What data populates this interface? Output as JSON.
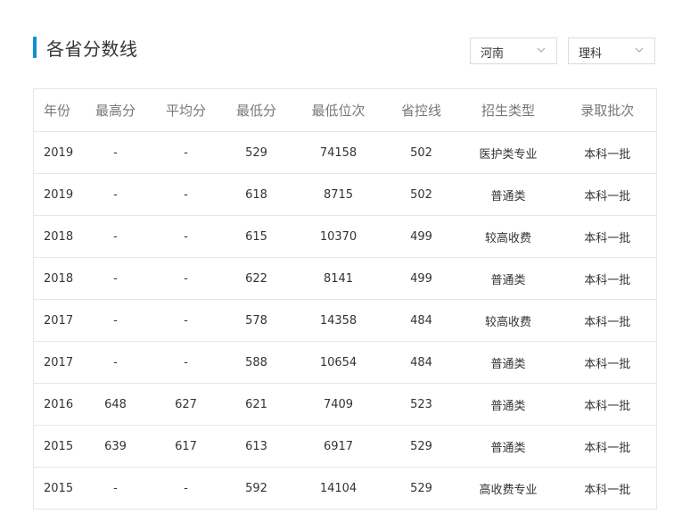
{
  "section": {
    "title": "各省分数线",
    "accent_color": "#0f8fd6"
  },
  "filters": {
    "province": "河南",
    "subject": "理科"
  },
  "table": {
    "columns": [
      "年份",
      "最高分",
      "平均分",
      "最低分",
      "最低位次",
      "省控线",
      "招生类型",
      "录取批次"
    ],
    "rows": [
      [
        "2019",
        "-",
        "-",
        "529",
        "74158",
        "502",
        "医护类专业",
        "本科一批"
      ],
      [
        "2019",
        "-",
        "-",
        "618",
        "8715",
        "502",
        "普通类",
        "本科一批"
      ],
      [
        "2018",
        "-",
        "-",
        "615",
        "10370",
        "499",
        "较高收费",
        "本科一批"
      ],
      [
        "2018",
        "-",
        "-",
        "622",
        "8141",
        "499",
        "普通类",
        "本科一批"
      ],
      [
        "2017",
        "-",
        "-",
        "578",
        "14358",
        "484",
        "较高收费",
        "本科一批"
      ],
      [
        "2017",
        "-",
        "-",
        "588",
        "10654",
        "484",
        "普通类",
        "本科一批"
      ],
      [
        "2016",
        "648",
        "627",
        "621",
        "7409",
        "523",
        "普通类",
        "本科一批"
      ],
      [
        "2015",
        "639",
        "617",
        "613",
        "6917",
        "529",
        "普通类",
        "本科一批"
      ],
      [
        "2015",
        "-",
        "-",
        "592",
        "14104",
        "529",
        "高收费专业",
        "本科一批"
      ]
    ]
  }
}
